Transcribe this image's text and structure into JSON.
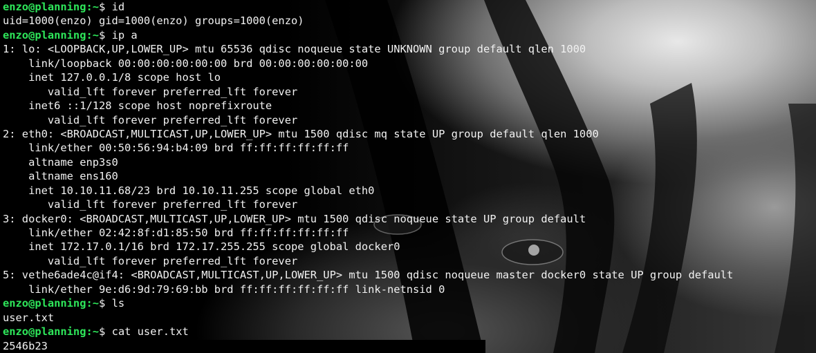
{
  "terminal": {
    "prompt_user_host": "enzo@planning",
    "prompt_suffix": ":~$",
    "lines": [
      {
        "kind": "cmd",
        "command": " id"
      },
      {
        "kind": "out",
        "text": "uid=1000(enzo) gid=1000(enzo) groups=1000(enzo)"
      },
      {
        "kind": "cmd",
        "command": " ip a"
      },
      {
        "kind": "out",
        "text": "1: lo: <LOOPBACK,UP,LOWER_UP> mtu 65536 qdisc noqueue state UNKNOWN group default qlen 1000"
      },
      {
        "kind": "out",
        "text": "    link/loopback 00:00:00:00:00:00 brd 00:00:00:00:00:00"
      },
      {
        "kind": "out",
        "text": "    inet 127.0.0.1/8 scope host lo"
      },
      {
        "kind": "out",
        "text": "       valid_lft forever preferred_lft forever"
      },
      {
        "kind": "out",
        "text": "    inet6 ::1/128 scope host noprefixroute"
      },
      {
        "kind": "out",
        "text": "       valid_lft forever preferred_lft forever"
      },
      {
        "kind": "out",
        "text": "2: eth0: <BROADCAST,MULTICAST,UP,LOWER_UP> mtu 1500 qdisc mq state UP group default qlen 1000"
      },
      {
        "kind": "out",
        "text": "    link/ether 00:50:56:94:b4:09 brd ff:ff:ff:ff:ff:ff"
      },
      {
        "kind": "out",
        "text": "    altname enp3s0"
      },
      {
        "kind": "out",
        "text": "    altname ens160"
      },
      {
        "kind": "out",
        "text": "    inet 10.10.11.68/23 brd 10.10.11.255 scope global eth0"
      },
      {
        "kind": "out",
        "text": "       valid_lft forever preferred_lft forever"
      },
      {
        "kind": "out",
        "text": "3: docker0: <BROADCAST,MULTICAST,UP,LOWER_UP> mtu 1500 qdisc noqueue state UP group default"
      },
      {
        "kind": "out",
        "text": "    link/ether 02:42:8f:d1:85:50 brd ff:ff:ff:ff:ff:ff"
      },
      {
        "kind": "out",
        "text": "    inet 172.17.0.1/16 brd 172.17.255.255 scope global docker0"
      },
      {
        "kind": "out",
        "text": "       valid_lft forever preferred_lft forever"
      },
      {
        "kind": "out",
        "text": "5: vethe6ade4c@if4: <BROADCAST,MULTICAST,UP,LOWER_UP> mtu 1500 qdisc noqueue master docker0 state UP group default"
      },
      {
        "kind": "out",
        "text": "    link/ether 9e:d6:9d:79:69:bb brd ff:ff:ff:ff:ff:ff link-netnsid 0"
      },
      {
        "kind": "cmd",
        "command": " ls"
      },
      {
        "kind": "out",
        "text": "user.txt"
      },
      {
        "kind": "cmd",
        "command": " cat user.txt"
      },
      {
        "kind": "out",
        "text": "2546b23"
      }
    ]
  },
  "colors": {
    "prompt": "#2ee65a",
    "text": "#f2f2f2",
    "background": "#050505"
  }
}
